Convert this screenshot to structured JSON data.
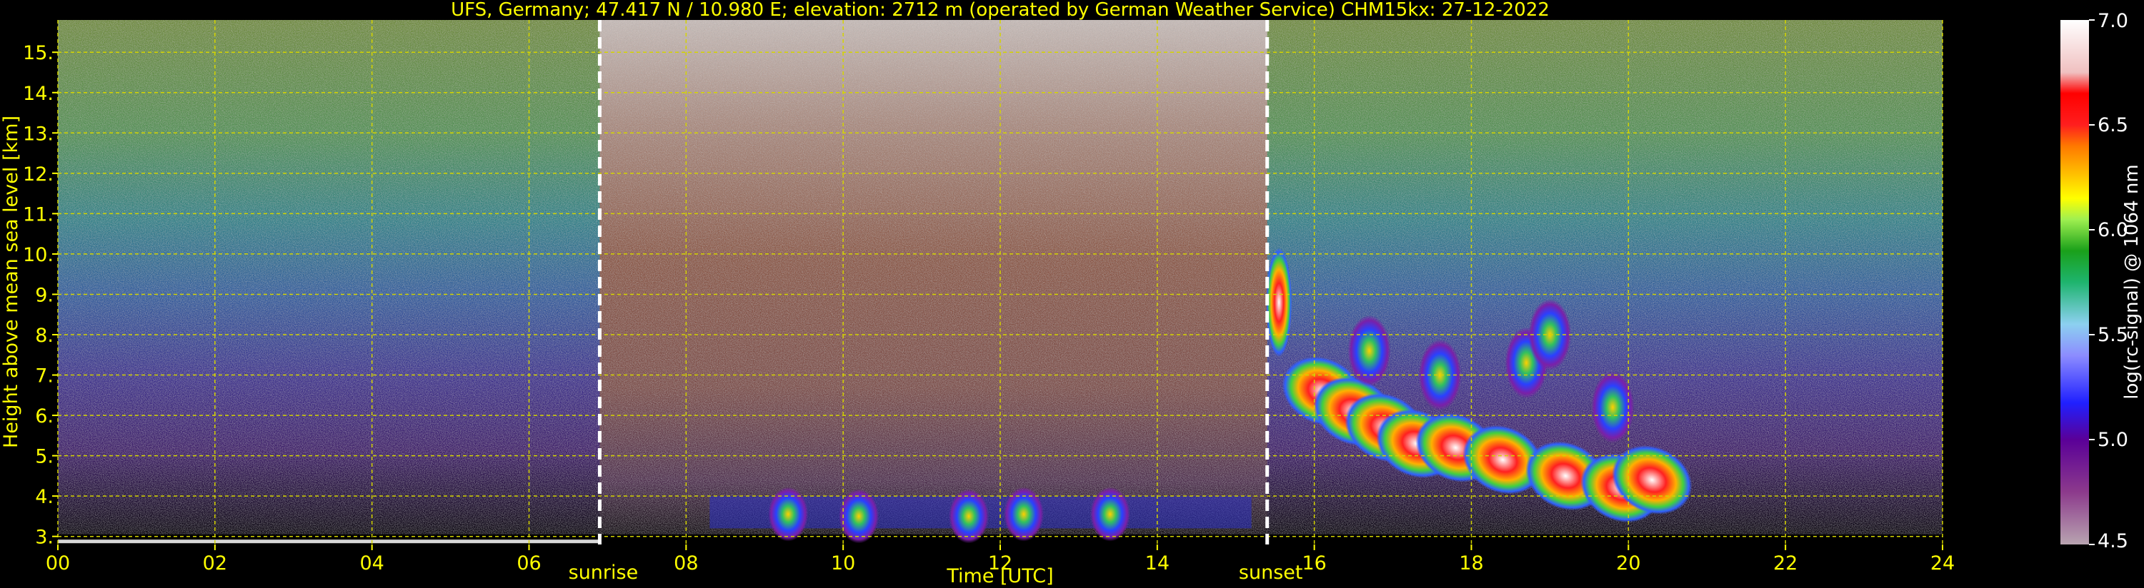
{
  "chart_data": {
    "type": "heatmap",
    "title": "UFS, Germany; 47.417 N / 10.980 E; elevation: 2712 m  (operated by German Weather Service)    CHM15kx: 27-12-2022",
    "xlabel": "Time [UTC]",
    "ylabel": "Height above mean sea level [km]",
    "xlim": [
      0,
      24
    ],
    "ylim": [
      2.8,
      15.8
    ],
    "x_ticks": [
      0,
      2,
      4,
      6,
      8,
      10,
      12,
      14,
      16,
      18,
      20,
      22,
      24
    ],
    "x_tick_labels": [
      "00",
      "02",
      "04",
      "06",
      "08",
      "10",
      "12",
      "14",
      "16",
      "18",
      "20",
      "22",
      "24"
    ],
    "y_ticks": [
      3,
      4,
      5,
      6,
      7,
      8,
      9,
      10,
      11,
      12,
      13,
      14,
      15
    ],
    "y_tick_labels": [
      "3.",
      "4.",
      "5.",
      "6.",
      "7.",
      "8.",
      "9.",
      "10.",
      "11.",
      "12.",
      "13.",
      "14.",
      "15."
    ],
    "grid": true,
    "annotations": [
      {
        "text": "sunrise",
        "x": 6.9
      },
      {
        "text": "sunset",
        "x": 15.4
      }
    ],
    "colorbar": {
      "label": "log(rc-signal) @ 1064 nm",
      "min": 4.5,
      "max": 7.0,
      "tick_labels": [
        "4.5",
        "5.0",
        "5.5",
        "6.0",
        "6.5",
        "7.0"
      ],
      "tick_values": [
        4.5,
        5.0,
        5.5,
        6.0,
        6.5,
        7.0
      ]
    },
    "cloud_features": [
      {
        "time_start": 9.5,
        "time_end": 13.5,
        "height_bottom": 3.2,
        "height_top": 4.0,
        "max_signal": 6.0
      },
      {
        "time_start": 15.3,
        "time_end": 16.0,
        "height_bottom": 7.5,
        "height_top": 10.2,
        "max_signal": 6.5
      },
      {
        "time_start": 16.0,
        "time_end": 20.5,
        "height_bottom": 3.5,
        "height_top": 8.5,
        "max_signal": 7.0
      }
    ],
    "colors": {
      "axis_text": "#ffff00",
      "grid": "#d4d400",
      "sun_markers": "#ffffff",
      "colorbar_text": "#ffffff"
    }
  }
}
